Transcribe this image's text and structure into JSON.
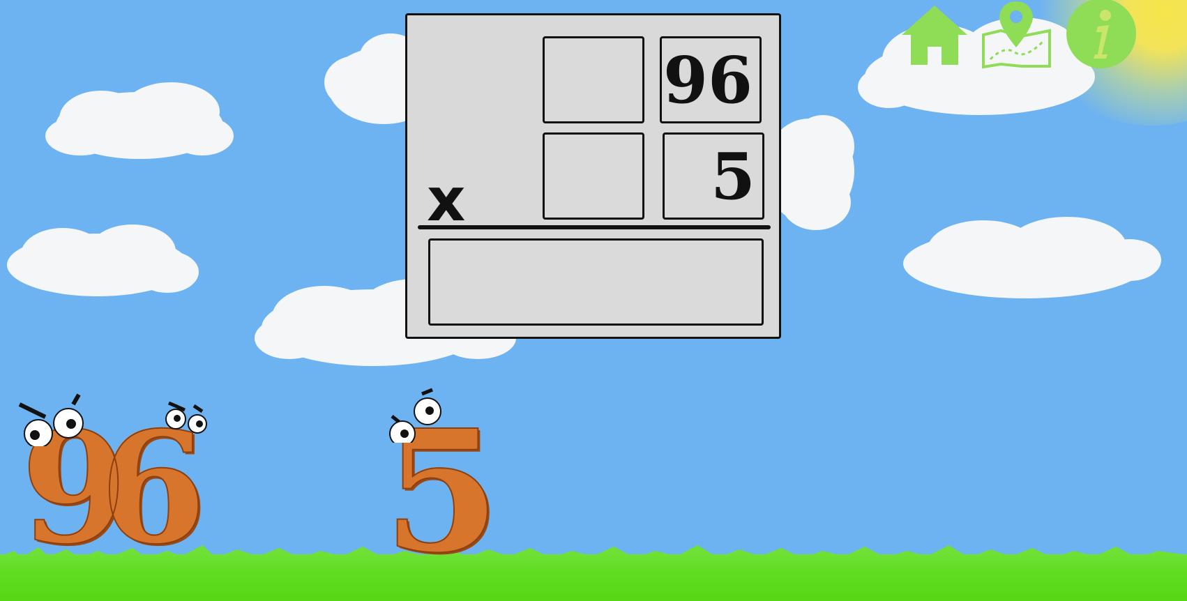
{
  "problem": {
    "multiplicand": "96",
    "multiplier": "5",
    "operator": "x",
    "multiplicand_tens_cell": "",
    "multiplier_tens_cell": "",
    "answer": ""
  },
  "characters": {
    "left_number": "96",
    "right_number": "5"
  },
  "toolbar": {
    "home_icon": "home-icon",
    "map_icon": "map-pin-icon",
    "info_icon": "info-icon"
  },
  "colors": {
    "sky": "#6db3f2",
    "grass": "#5fdc1f",
    "board": "#d9d9d9",
    "icon_green": "#8fdc56",
    "character_orange": "#d7752c"
  }
}
